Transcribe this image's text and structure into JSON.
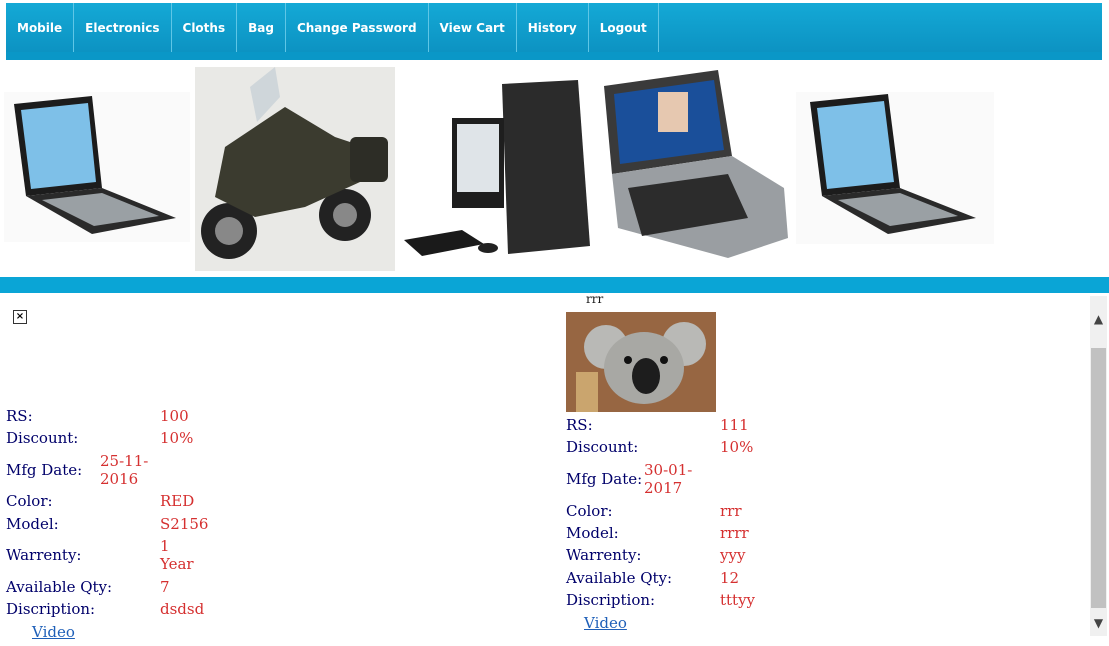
{
  "nav": {
    "items": [
      "Mobile",
      "Electronics",
      "Cloths",
      "Bag",
      "Change Password",
      "View Cart",
      "History",
      "Logout"
    ]
  },
  "banner": {
    "images": [
      "laptop-image",
      "motorcycle-image",
      "desktop-computer-image",
      "mobile-phone-image",
      "laptop-image"
    ]
  },
  "products": [
    {
      "caption": "",
      "image": "broken-image-icon",
      "rs_label": "RS:",
      "rs": "100",
      "discount_label": "Discount:",
      "discount": "10%",
      "mfg_label": "Mfg Date:",
      "mfg_line1": "25-11-",
      "mfg_line2": "2016",
      "color_label": "Color:",
      "color": "RED",
      "model_label": "Model:",
      "model": "S2156",
      "warranty_label": "Warrenty:",
      "warranty_line1": "1",
      "warranty_line2": "Year",
      "qty_label": "Available Qty:",
      "qty": "7",
      "desc_label": "Discription:",
      "desc": "dsdsd",
      "video_link": "Video"
    },
    {
      "caption": "rrr",
      "image": "koala-image",
      "rs_label": "RS:",
      "rs": "111",
      "discount_label": "Discount:",
      "discount": "10%",
      "mfg_label": "Mfg Date:",
      "mfg_line1": "30-01-",
      "mfg_line2": "2017",
      "color_label": "Color:",
      "color": "rrr",
      "model_label": "Model:",
      "model": "rrrr",
      "warranty_label": "Warrenty:",
      "warranty": "yyy",
      "qty_label": "Available Qty:",
      "qty": "12",
      "desc_label": "Discription:",
      "desc": "tttyy",
      "video_link": "Video"
    }
  ],
  "colors": {
    "nav_bg": "#0b8fbf",
    "band": "#0aa5d6",
    "label": "#00006a",
    "value": "#d53030",
    "link": "#1e5fb8"
  }
}
